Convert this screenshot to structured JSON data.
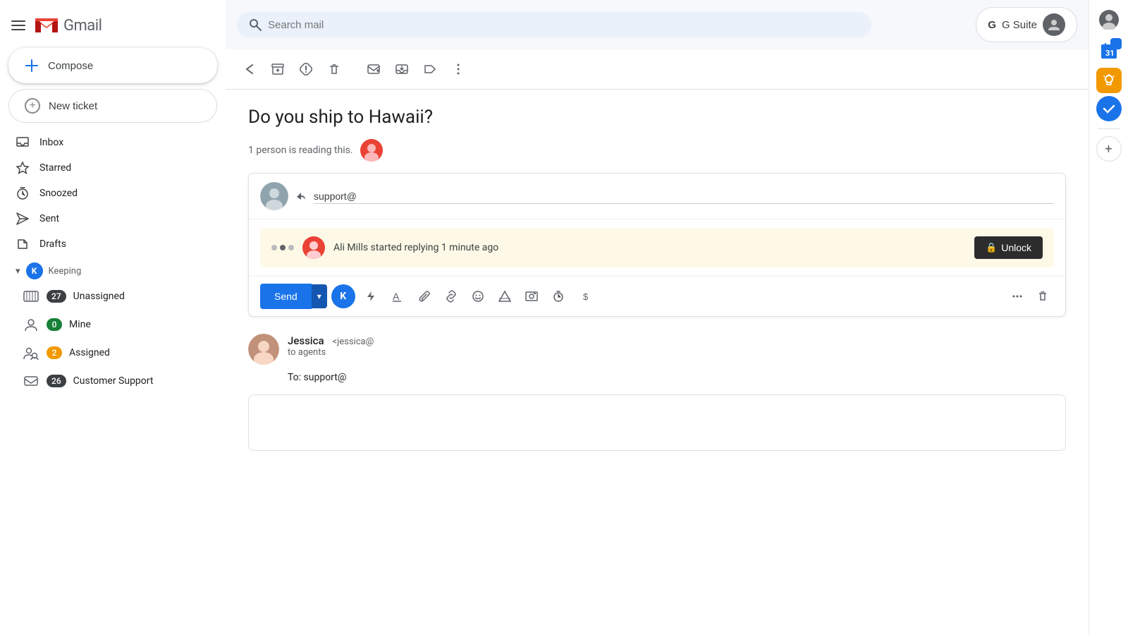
{
  "app": {
    "title": "Gmail",
    "logo_m": "M",
    "logo_text": "Gmail"
  },
  "gsuite": {
    "label": "G Suite",
    "g": "G",
    "suite": " Suite"
  },
  "search": {
    "placeholder": "Search mail"
  },
  "compose": {
    "label": "Compose"
  },
  "new_ticket": {
    "label": "New ticket"
  },
  "sidebar": {
    "nav": [
      {
        "id": "inbox",
        "label": "Inbox",
        "icon": "☰"
      },
      {
        "id": "starred",
        "label": "Starred",
        "icon": "★"
      },
      {
        "id": "snoozed",
        "label": "Snoozed",
        "icon": "🕐"
      },
      {
        "id": "sent",
        "label": "Sent",
        "icon": "▶"
      },
      {
        "id": "drafts",
        "label": "Drafts",
        "icon": "📄"
      }
    ],
    "keeping_section": "Keeping",
    "sub_items": [
      {
        "id": "unassigned",
        "label": "Unassigned",
        "badge": "27",
        "badge_color": "dark"
      },
      {
        "id": "mine",
        "label": "Mine",
        "badge": "0",
        "badge_color": "green"
      },
      {
        "id": "assigned",
        "label": "Assigned",
        "badge": "2",
        "badge_color": "orange"
      },
      {
        "id": "customer-support",
        "label": "Customer Support",
        "badge": "26",
        "badge_color": "dark"
      }
    ]
  },
  "email": {
    "subject": "Do you ship to Hawaii?",
    "reading_text": "1 person is reading this.",
    "reply_to": "support@",
    "unlock_banner": {
      "typer_name": "Ali Mills",
      "text": "Ali Mills started replying 1 minute ago",
      "unlock_label": "Unlock"
    },
    "send_label": "Send",
    "sender": {
      "name": "Jessica",
      "email": "<jessica@",
      "to": "to agents",
      "body_line1": "To: support@"
    }
  },
  "toolbar": {
    "back": "←",
    "archive": "⤓",
    "spam": "⚠",
    "delete": "🗑",
    "email_icon": "✉",
    "inbox_arrow": "⤓",
    "label": "🏷",
    "more": "⋮"
  }
}
